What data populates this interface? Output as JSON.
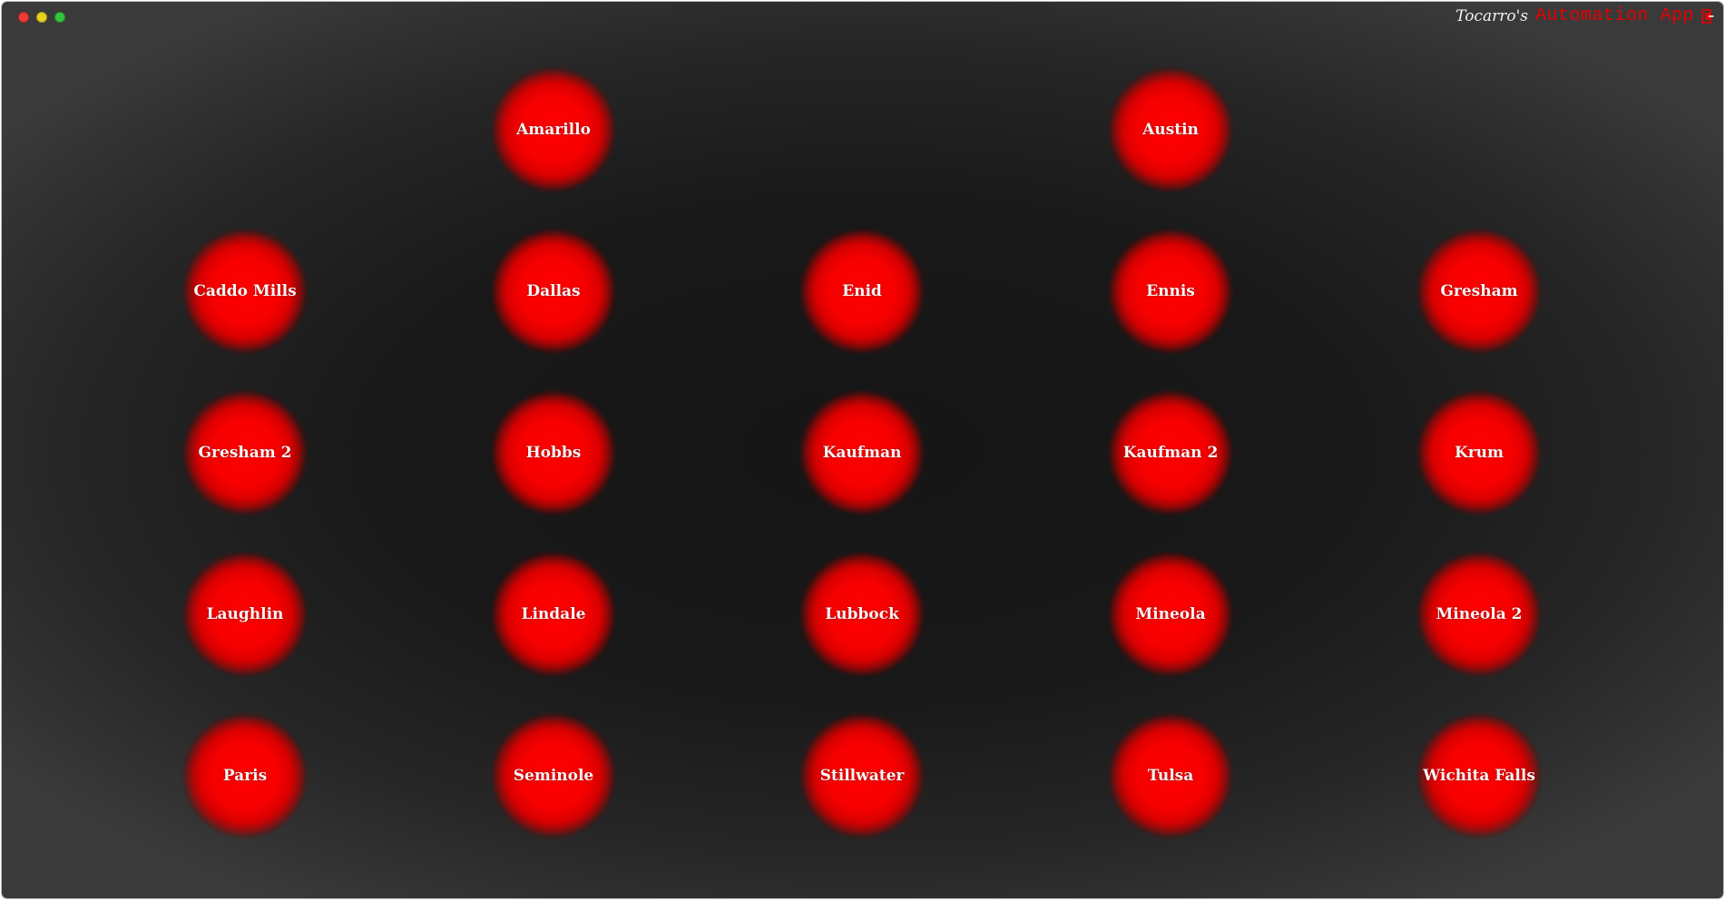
{
  "window": {
    "controls": [
      "close",
      "minimize",
      "maximize"
    ]
  },
  "header": {
    "owner": "Tocarro's",
    "app_name": "Automation App",
    "logout_icon": "logout-icon"
  },
  "colors": {
    "accent": "#e60000",
    "node": "#ff0000",
    "background": "#181818"
  },
  "locations": [
    {
      "label": "Amarillo"
    },
    {
      "label": "Austin"
    },
    {
      "label": "Caddo Mills"
    },
    {
      "label": "Dallas"
    },
    {
      "label": "Enid"
    },
    {
      "label": "Ennis"
    },
    {
      "label": "Gresham"
    },
    {
      "label": "Gresham 2"
    },
    {
      "label": "Hobbs"
    },
    {
      "label": "Kaufman"
    },
    {
      "label": "Kaufman 2"
    },
    {
      "label": "Krum"
    },
    {
      "label": "Laughlin"
    },
    {
      "label": "Lindale"
    },
    {
      "label": "Lubbock"
    },
    {
      "label": "Mineola"
    },
    {
      "label": "Mineola 2"
    },
    {
      "label": "Paris"
    },
    {
      "label": "Seminole"
    },
    {
      "label": "Stillwater"
    },
    {
      "label": "Tulsa"
    },
    {
      "label": "Wichita Falls"
    }
  ]
}
